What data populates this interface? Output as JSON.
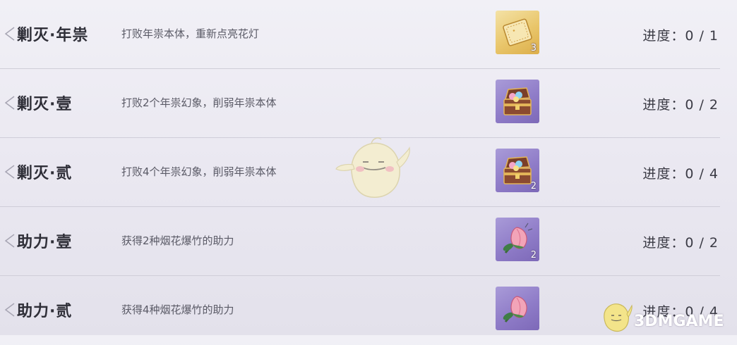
{
  "tasks": [
    {
      "title": "剿灭·年祟",
      "description": "打败年祟本体，重新点亮花灯",
      "reward": {
        "icon": "ticket-icon",
        "count": "3",
        "color": "#e9c66b"
      },
      "progress": "进度：0 / 1"
    },
    {
      "title": "剿灭·壹",
      "description": "打败2个年祟幻象，削弱年祟本体",
      "reward": {
        "icon": "treasure-chest-icon",
        "count": "",
        "color": "#8f7cc8"
      },
      "progress": "进度：0 / 2"
    },
    {
      "title": "剿灭·贰",
      "description": "打败4个年祟幻象，削弱年祟本体",
      "reward": {
        "icon": "treasure-chest-icon",
        "count": "2",
        "color": "#8f7cc8"
      },
      "progress": "进度：0 / 4"
    },
    {
      "title": "助力·壹",
      "description": "获得2种烟花爆竹的助力",
      "reward": {
        "icon": "flower-bud-icon",
        "count": "2",
        "color": "#8f7cc8"
      },
      "progress": "进度：0 / 2"
    },
    {
      "title": "助力·贰",
      "description": "获得4种烟花爆竹的助力",
      "reward": {
        "icon": "flower-bud-icon",
        "count": "",
        "color": "#8f7cc8"
      },
      "progress": "进度：0 / 4"
    }
  ],
  "watermark": {
    "text": "3DMGAME"
  }
}
